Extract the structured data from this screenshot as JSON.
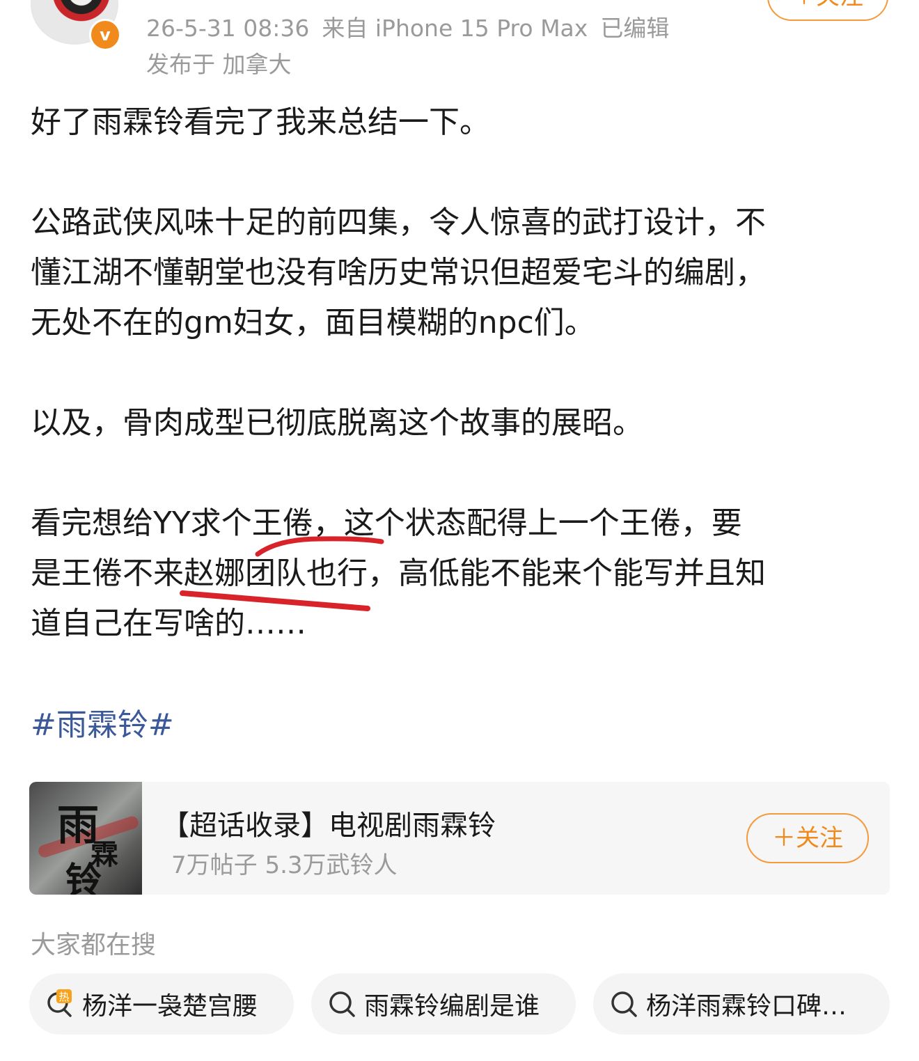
{
  "header": {
    "timestamp": "26-5-31 08:36",
    "source": "来自 iPhone 15 Pro Max",
    "edited": "已编辑",
    "location": "发布于 加拿大",
    "follow_label": "＋关注",
    "verified_badge": "v"
  },
  "post": {
    "line1": "好了雨霖铃看完了我来总结一下。",
    "para2": [
      "公路武侠风味十足的前四集，令人惊喜的武打设计，不",
      "懂江湖不懂朝堂也没有啥历史常识但超爱宅斗的编剧，",
      "无处不在的gm妇女，面目模糊的npc们。"
    ],
    "para3": "以及，骨肉成型已彻底脱离这个故事的展昭。",
    "para4": [
      "看完想给YY求个王倦，这个状态配得上一个王倦，要",
      "是王倦不来赵娜团队也行，高低能不能来个能写并且知",
      "道自己在写啥的……"
    ]
  },
  "hashtag": "#雨霖铃#",
  "topic_card": {
    "title": "【超话收录】电视剧雨霖铃",
    "subtitle": "7万帖子 5.3万武铃人",
    "follow_label": "＋关注",
    "thumb_chars": [
      "雨",
      "霖",
      "铃"
    ]
  },
  "search": {
    "label": "大家都在搜",
    "items": [
      {
        "text": "杨洋一袅楚宫腰",
        "icon": "hot-search-icon"
      },
      {
        "text": "雨霖铃编剧是谁",
        "icon": "search-icon"
      },
      {
        "text": "杨洋雨霖铃口碑…",
        "icon": "search-icon"
      }
    ]
  },
  "colors": {
    "accent": "#f08a1c",
    "link": "#3b5998",
    "underline_mark": "#d8232a",
    "muted": "#9a9a9a"
  }
}
